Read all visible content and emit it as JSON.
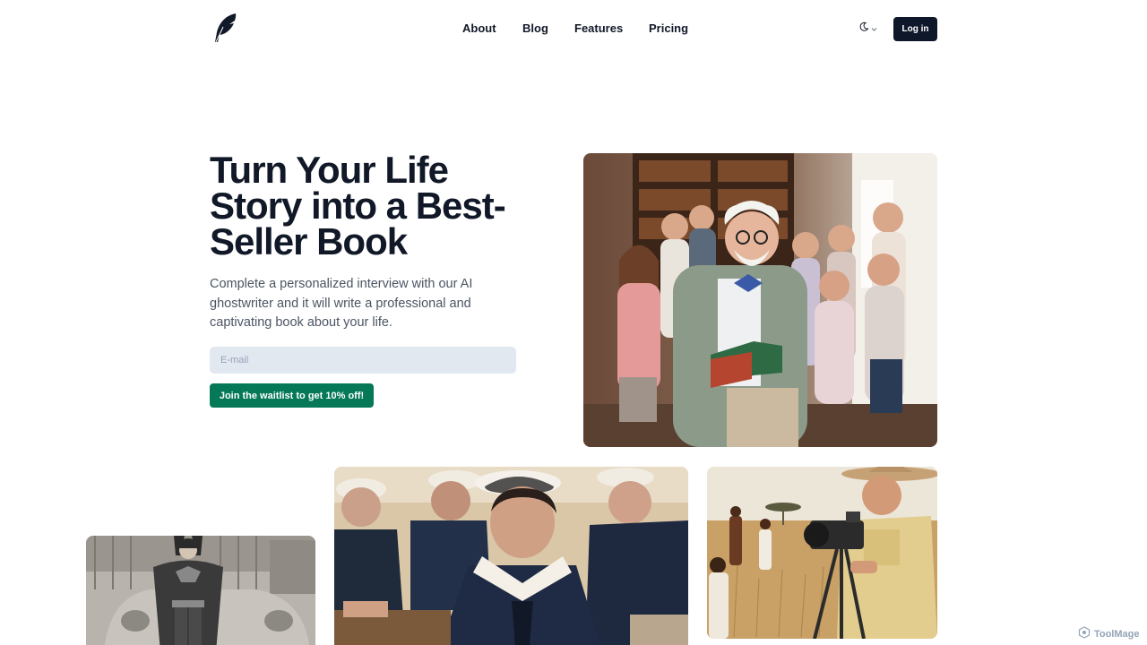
{
  "header": {
    "logo_icon": "feather-icon",
    "nav": [
      {
        "label": "About"
      },
      {
        "label": "Blog"
      },
      {
        "label": "Features"
      },
      {
        "label": "Pricing"
      }
    ],
    "theme_toggle_icon": "moon-icon",
    "login_label": "Log in"
  },
  "hero": {
    "title": "Turn Your Life Story into a Best-Seller Book",
    "subtitle": "Complete a personalized interview with our AI ghostwriter and it will write a professional and captivating book about your life.",
    "email_placeholder": "E-mail",
    "email_value": "",
    "cta_label": "Join the waitlist to get 10% off!"
  },
  "photos": [
    {
      "name": "grandfather-with-children-photo"
    },
    {
      "name": "superhero-costume-photo"
    },
    {
      "name": "sailors-photo"
    },
    {
      "name": "safari-cameraman-photo"
    }
  ],
  "watermark": "ToolMage",
  "colors": {
    "primary_dark": "#0f172a",
    "accent_green": "#047857",
    "input_bg": "#e2e8f0",
    "text_muted": "#4b5563"
  }
}
